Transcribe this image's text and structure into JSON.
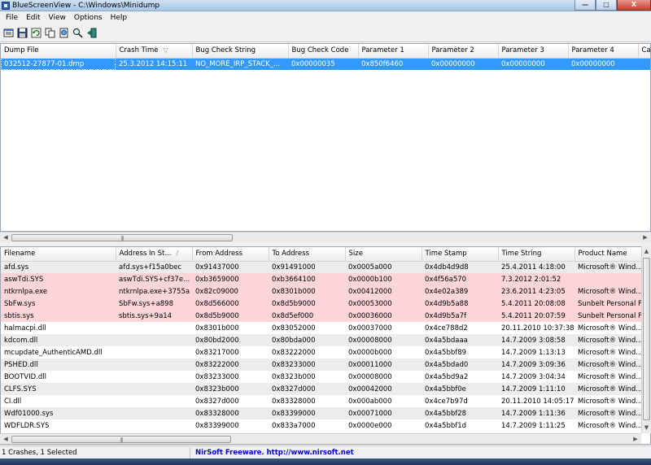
{
  "window": {
    "title": "BlueScreenView  -  C:\\Windows\\Minidump",
    "controls": {
      "minimize": "—",
      "maximize": "□",
      "close": "X"
    }
  },
  "menu": [
    "File",
    "Edit",
    "View",
    "Options",
    "Help"
  ],
  "toolbar": {
    "icons": [
      "properties-icon",
      "save-icon",
      "refresh-icon",
      "copy-icon",
      "html-report-icon",
      "find-icon",
      "exit-icon"
    ]
  },
  "crashes": {
    "columns": [
      "Dump File",
      "Crash Time",
      "Bug Check String",
      "Bug Check Code",
      "Parameter 1",
      "Parameter 2",
      "Parameter 3",
      "Parameter 4",
      "Ca"
    ],
    "rows": [
      [
        "032512-27877-01.dmp",
        "25.3.2012 14:15:11",
        "NO_MORE_IRP_STACK_...",
        "0x00000035",
        "0x850f6460",
        "0x00000000",
        "0x00000000",
        "0x00000000",
        ""
      ]
    ]
  },
  "drivers": {
    "columns": [
      "Filename",
      "Address In St...",
      "From Address",
      "To Address",
      "Size",
      "Time Stamp",
      "Time String",
      "Product Name"
    ],
    "rows": [
      [
        "afd.sys",
        "afd.sys+f15a0bec",
        "0x91437000",
        "0x91491000",
        "0x0005a000",
        "0x4db4d9d8",
        "25.4.2011 4:18:00",
        "Microsoft® Wind..."
      ],
      [
        "aswTdi.SYS",
        "aswTdi.SYS+cf37e...",
        "0xb3659000",
        "0xb3664100",
        "0x0000b100",
        "0x4f56a570",
        "7.3.2012 2:01:52",
        ""
      ],
      [
        "ntkrnlpa.exe",
        "ntkrnlpa.exe+3755a",
        "0x82c09000",
        "0x8301b000",
        "0x00412000",
        "0x4e02a389",
        "23.6.2011 4:23:05",
        "Microsoft® Wind..."
      ],
      [
        "SbFw.sys",
        "SbFw.sys+a898",
        "0x8d566000",
        "0x8d5b9000",
        "0x00053000",
        "0x4d9b5a88",
        "5.4.2011 20:08:08",
        "Sunbelt Personal F..."
      ],
      [
        "sbtis.sys",
        "sbtis.sys+9a14",
        "0x8d5b9000",
        "0x8d5ef000",
        "0x00036000",
        "0x4d9b5a7f",
        "5.4.2011 20:07:59",
        "Sunbelt Personal F..."
      ],
      [
        "halmacpi.dll",
        "",
        "0x8301b000",
        "0x83052000",
        "0x00037000",
        "0x4ce788d2",
        "20.11.2010 10:37:38",
        "Microsoft® Wind..."
      ],
      [
        "kdcom.dll",
        "",
        "0x80bd2000",
        "0x80bda000",
        "0x00008000",
        "0x4a5bdaaa",
        "14.7.2009 3:08:58",
        "Microsoft® Wind..."
      ],
      [
        "mcupdate_AuthenticAMD.dll",
        "",
        "0x83217000",
        "0x83222000",
        "0x0000b000",
        "0x4a5bbf89",
        "14.7.2009 1:13:13",
        "Microsoft® Wind..."
      ],
      [
        "PSHED.dll",
        "",
        "0x83222000",
        "0x83233000",
        "0x00011000",
        "0x4a5bdad0",
        "14.7.2009 3:09:36",
        "Microsoft® Wind..."
      ],
      [
        "BOOTVID.dll",
        "",
        "0x83233000",
        "0x8323b000",
        "0x00008000",
        "0x4a5bd9a2",
        "14.7.2009 3:04:34",
        "Microsoft® Wind..."
      ],
      [
        "CLFS.SYS",
        "",
        "0x8323b000",
        "0x8327d000",
        "0x00042000",
        "0x4a5bbf0e",
        "14.7.2009 1:11:10",
        "Microsoft® Wind..."
      ],
      [
        "CI.dll",
        "",
        "0x8327d000",
        "0x83328000",
        "0x000ab000",
        "0x4ce7b97d",
        "20.11.2010 14:05:17",
        "Microsoft® Wind..."
      ],
      [
        "Wdf01000.sys",
        "",
        "0x83328000",
        "0x83399000",
        "0x00071000",
        "0x4a5bbf28",
        "14.7.2009 1:11:36",
        "Microsoft® Wind..."
      ],
      [
        "WDFLDR.SYS",
        "",
        "0x83399000",
        "0x833a7000",
        "0x0000e000",
        "0x4a5bbf1d",
        "14.7.2009 1:11:25",
        "Microsoft® Wind..."
      ]
    ],
    "highlighted_rows": [
      1,
      2,
      3,
      4
    ]
  },
  "status": {
    "summary": "1 Crashes, 1 Selected",
    "link": "NirSoft Freeware.  http://www.nirsoft.net"
  },
  "colors": {
    "selection": "#3399ff",
    "highlight_row": "#fbd5d8",
    "link": "#0000cc"
  }
}
